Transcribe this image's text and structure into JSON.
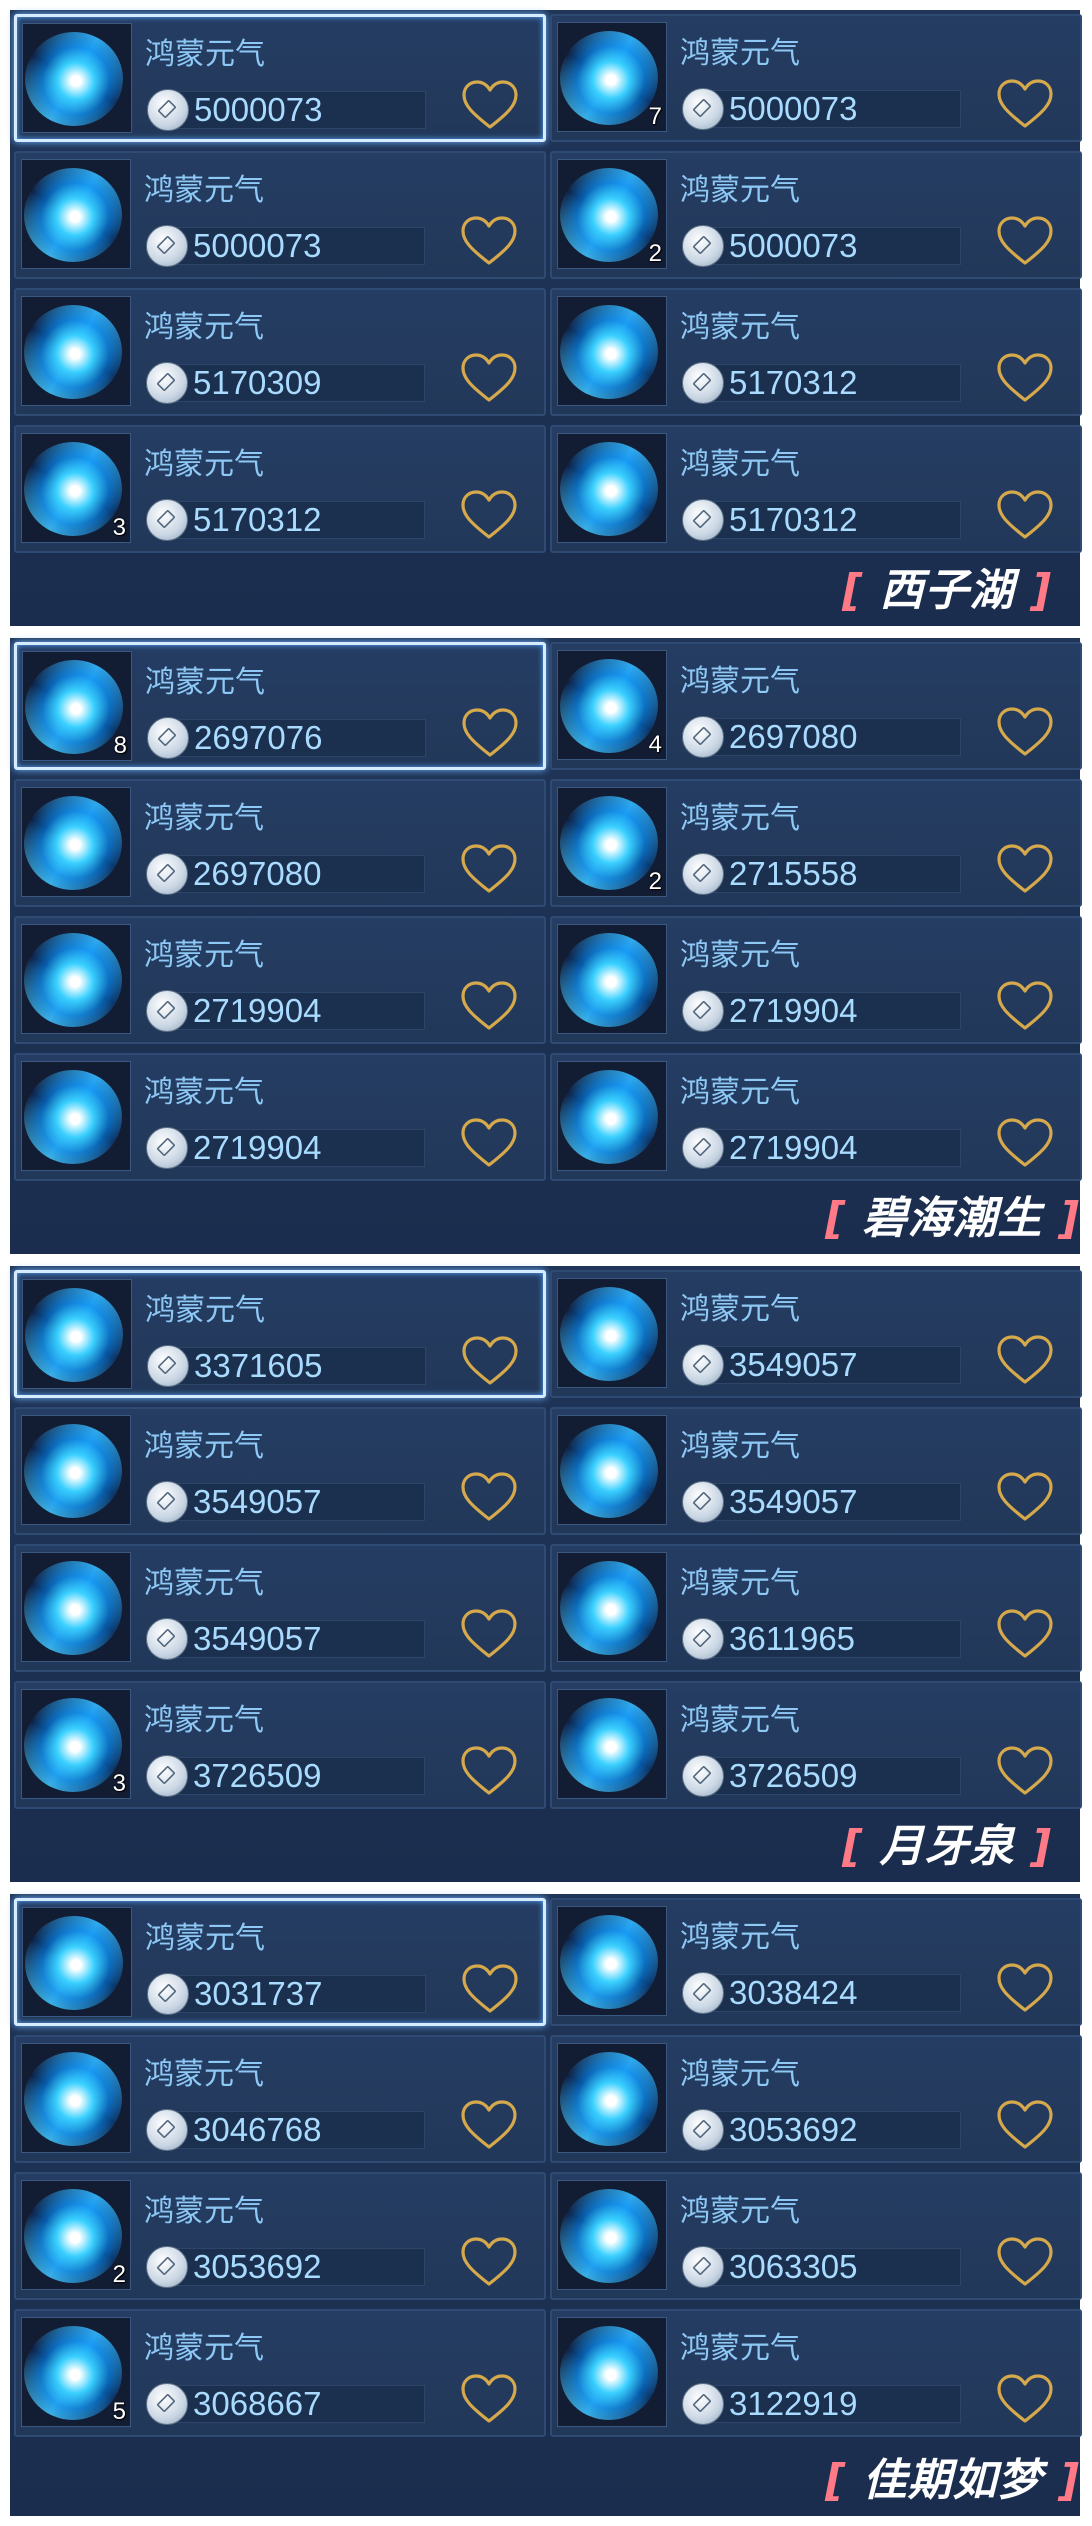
{
  "item_name": "鸿蒙元气",
  "sections": [
    {
      "label": "西子湖",
      "items": [
        {
          "price": "5000073",
          "count": ""
        },
        {
          "price": "5000073",
          "count": "7"
        },
        {
          "price": "5000073",
          "count": ""
        },
        {
          "price": "5000073",
          "count": "2"
        },
        {
          "price": "5170309",
          "count": ""
        },
        {
          "price": "5170312",
          "count": ""
        },
        {
          "price": "5170312",
          "count": "3"
        },
        {
          "price": "5170312",
          "count": ""
        }
      ]
    },
    {
      "label": "碧海潮生",
      "items": [
        {
          "price": "2697076",
          "count": "8"
        },
        {
          "price": "2697080",
          "count": "4"
        },
        {
          "price": "2697080",
          "count": ""
        },
        {
          "price": "2715558",
          "count": "2"
        },
        {
          "price": "2719904",
          "count": ""
        },
        {
          "price": "2719904",
          "count": ""
        },
        {
          "price": "2719904",
          "count": ""
        },
        {
          "price": "2719904",
          "count": ""
        }
      ]
    },
    {
      "label": "月牙泉",
      "items": [
        {
          "price": "3371605",
          "count": ""
        },
        {
          "price": "3549057",
          "count": ""
        },
        {
          "price": "3549057",
          "count": ""
        },
        {
          "price": "3549057",
          "count": ""
        },
        {
          "price": "3549057",
          "count": ""
        },
        {
          "price": "3611965",
          "count": ""
        },
        {
          "price": "3726509",
          "count": "3"
        },
        {
          "price": "3726509",
          "count": ""
        }
      ]
    },
    {
      "label": "佳期如梦",
      "items": [
        {
          "price": "3031737",
          "count": ""
        },
        {
          "price": "3038424",
          "count": ""
        },
        {
          "price": "3046768",
          "count": ""
        },
        {
          "price": "3053692",
          "count": ""
        },
        {
          "price": "3053692",
          "count": "2"
        },
        {
          "price": "3063305",
          "count": ""
        },
        {
          "price": "3068667",
          "count": "5"
        },
        {
          "price": "3122919",
          "count": ""
        }
      ]
    }
  ],
  "icons": {
    "item": "spiral-energy-orb-icon",
    "currency": "silver-coin-icon",
    "favorite": "heart-outline-icon"
  },
  "colors": {
    "panel_bg": "#1e3255",
    "name_text": "#8ec9f6",
    "price_text": "#a9dbff",
    "heart": "#d5a94c",
    "selected_border": "#d6ecff",
    "bracket": "#ff7a86"
  }
}
